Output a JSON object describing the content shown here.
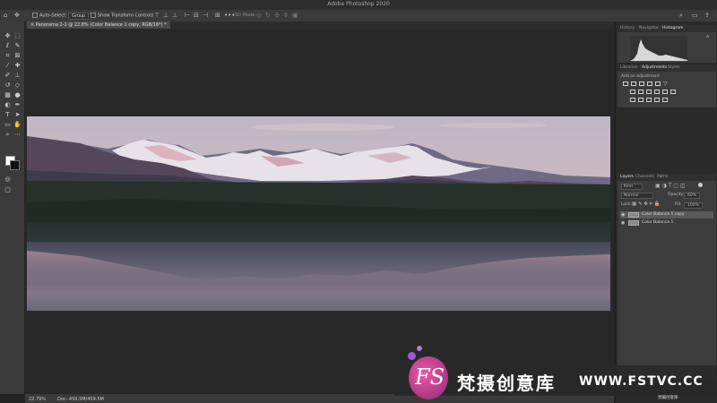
{
  "window": {
    "title": "Adobe Photoshop 2020"
  },
  "options_bar": {
    "auto_select_label": "Auto-Select:",
    "auto_select_value": "Group",
    "transform_label": "Show Transform Controls",
    "mode_3d_label": "3D Mode:"
  },
  "document": {
    "tab_title": "Panorama 2-1 @ 22.8% (Color Balance 1 copy, RGB/16*) *",
    "zoom": "22.79%",
    "doc_info": "Doc: 459.5M/459.5M"
  },
  "histogram_panel": {
    "tabs": [
      "History",
      "Navigator",
      "Histogram"
    ],
    "active_tab": "Histogram"
  },
  "adjustments_panel": {
    "tabs": [
      "Libraries",
      "Adjustments",
      "Styles"
    ],
    "active_tab": "Adjustments",
    "add_label": "Add an adjustment"
  },
  "layers_panel": {
    "tabs": [
      "Layers",
      "Channels",
      "Paths"
    ],
    "active_tab": "Layers",
    "filter_kind": "Kind",
    "blend_mode": "Normal",
    "opacity_label": "Opacity:",
    "opacity_value": "60%",
    "lock_label": "Lock:",
    "fill_label": "Fill:",
    "fill_value": "100%",
    "layers": [
      {
        "name": "Color Balance 1 copy",
        "selected": true
      },
      {
        "name": "Color Balance 1",
        "selected": false
      }
    ]
  },
  "watermark": {
    "logo_text": "FS",
    "cn_text": "梵摄创意库",
    "en_text": "WWW.FSTVC.CC",
    "small_text": "梵摄创意库"
  }
}
